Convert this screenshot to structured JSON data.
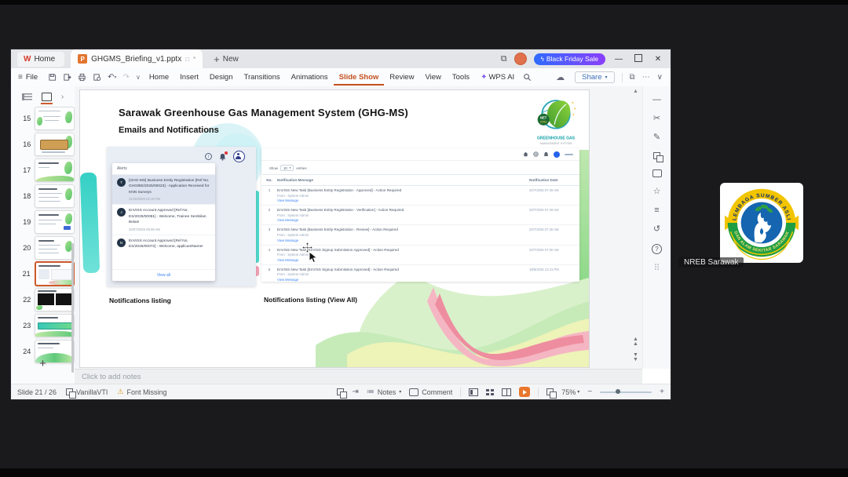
{
  "meeting": {
    "participant_label": "NREB Sarawak"
  },
  "window": {
    "tabbar": {
      "home_label": "Home",
      "doc_title": "GHGMS_Briefing_v1.pptx",
      "new_label": "New",
      "sale_label": "Black Friday Sale"
    },
    "menubar": {
      "file_label": "File",
      "items": [
        {
          "label": "Home"
        },
        {
          "label": "Insert"
        },
        {
          "label": "Design"
        },
        {
          "label": "Transitions"
        },
        {
          "label": "Animations"
        },
        {
          "label": "Slide Show"
        },
        {
          "label": "Review"
        },
        {
          "label": "View"
        },
        {
          "label": "Tools"
        }
      ],
      "ai_label": "WPS AI",
      "share_label": "Share"
    },
    "notes_placeholder": "Click to add notes",
    "statusbar": {
      "slide_counter": "Slide 21 / 26",
      "theme_name": "VanillaVTI",
      "font_missing": "Font Missing",
      "notes_label": "Notes",
      "comment_label": "Comment",
      "zoom_level": "75%"
    }
  },
  "thumbnails": {
    "numbers": [
      "15",
      "16",
      "17",
      "18",
      "19",
      "20",
      "21",
      "22",
      "23",
      "24"
    ],
    "add_label": "+"
  },
  "slide": {
    "title": "Sarawak Greenhouse Gas Management System (GHG-MS)",
    "subtitle": "Emails and Notifications",
    "logo": {
      "name_line1": "GREENHOUSE GAS",
      "name_line2": "MANAGEMENT SYSTEM",
      "badge_line1": "NET",
      "badge_line2": "2050"
    },
    "captions": {
      "left": "Notifications listing",
      "right": "Notifications listing (View All)"
    },
    "alerts_panel": {
      "header": "Alerts",
      "view_all": "View all",
      "items": [
        {
          "avatar": "T",
          "text": "[GHG-MS] Business Entity Registration [Ref No. GHG/BE/2025/00023] - Application Received for KNN Surveys",
          "time": "21/10/2025 02:19 PM"
        },
        {
          "avatar": "J",
          "text": "EnVISS Account Approved [Ref No. ES/2025/00081] - Welcome, Trainee Sembilan Belas!",
          "time": "30/07/2025 09:09 AM"
        },
        {
          "avatar": "N",
          "text": "EnVISS Account Approved [Ref No. ES/2025/00072] - Welcome, applicantName!",
          "time": ""
        }
      ]
    },
    "table_panel": {
      "show_label": "Show",
      "page_size": "10",
      "entries_label": "entries",
      "headers": {
        "no": "No.",
        "message": "Notification Message",
        "date": "Notification Date"
      },
      "from_label": "From : System Admin",
      "link_label": "View Message",
      "rows": [
        {
          "no": "1",
          "message": "EnVISS New Task [Business Entity Registration - Approved] - Action Required",
          "date": "20/7/2025 07:49 AM"
        },
        {
          "no": "2",
          "message": "EnVISS New Task [Business Entity Registration - Verification] - Action Required",
          "date": "20/7/2025 07:49 AM"
        },
        {
          "no": "3",
          "message": "EnVISS New Task [Business Entity Registration - Review] - Action Required",
          "date": "20/7/2025 07:46 AM"
        },
        {
          "no": "4",
          "message": "EnVISS New Task [EnVISS Signup Submission Approved] - Action Required",
          "date": "20/7/2025 07:30 AM"
        },
        {
          "no": "5",
          "message": "EnVISS New Task [EnVISS Signup Submission Approved] - Action Required",
          "date": "18/6/2025 12:41 PM"
        }
      ]
    }
  },
  "nreb_logo": {
    "arc_top": "LEMBAGA SUMBER ASLI",
    "arc_bottom": "DAN ALAM SEKITAR SARAWAK"
  },
  "colors": {
    "accent_orange": "#c4501e",
    "sale_gradient_start": "#2f6bff",
    "sale_gradient_end": "#8a3ffc",
    "play_button": "#e8762c",
    "link_blue": "#3b82f6"
  }
}
